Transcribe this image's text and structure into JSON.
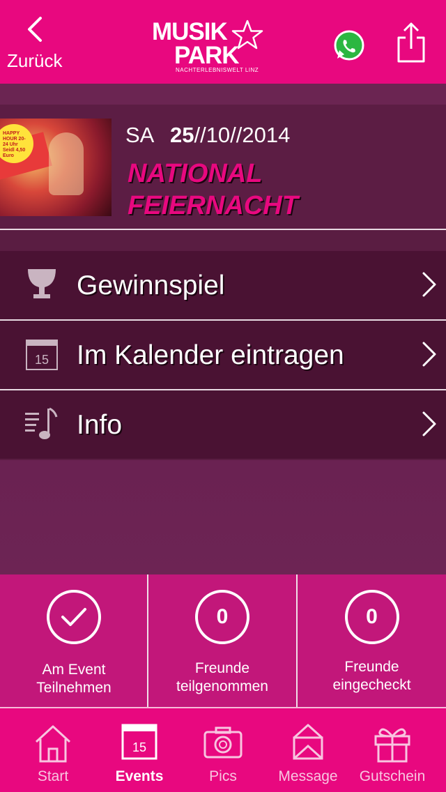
{
  "header": {
    "back_label": "Zurück",
    "logo_line1": "MUSIK",
    "logo_line2": "PARK",
    "logo_tagline": "NACHTERLEBNISWELT LINZ",
    "brand_color": "#e8087f"
  },
  "event": {
    "weekday": "SA",
    "day": "25",
    "month_year": "//10//2014",
    "title_line1": "NATIONAL",
    "title_line2": "FEIERNACHT",
    "thumb_badge": "HAPPY HOUR 20-24 Uhr Seidl 4,50 Euro"
  },
  "menu": [
    {
      "label": "Gewinnspiel",
      "icon": "trophy-icon"
    },
    {
      "label": "Im Kalender eintragen",
      "icon": "calendar-icon",
      "icon_text": "15"
    },
    {
      "label": "Info",
      "icon": "music-note-icon"
    }
  ],
  "stats": [
    {
      "label_line1": "Am Event",
      "label_line2": "Teilnehmen",
      "icon": "checkmark-icon"
    },
    {
      "value": "0",
      "label_line1": "Freunde",
      "label_line2": "teilgenommen"
    },
    {
      "value": "0",
      "label_line1": "Freunde",
      "label_line2": "eingecheckt"
    }
  ],
  "tabs": [
    {
      "label": "Start",
      "icon": "home-icon",
      "active": false
    },
    {
      "label": "Events",
      "icon": "calendar-icon",
      "icon_text": "15",
      "active": true
    },
    {
      "label": "Pics",
      "icon": "camera-icon",
      "active": false
    },
    {
      "label": "Message",
      "icon": "envelope-icon",
      "active": false
    },
    {
      "label": "Gutschein",
      "icon": "gift-icon",
      "active": false
    }
  ]
}
